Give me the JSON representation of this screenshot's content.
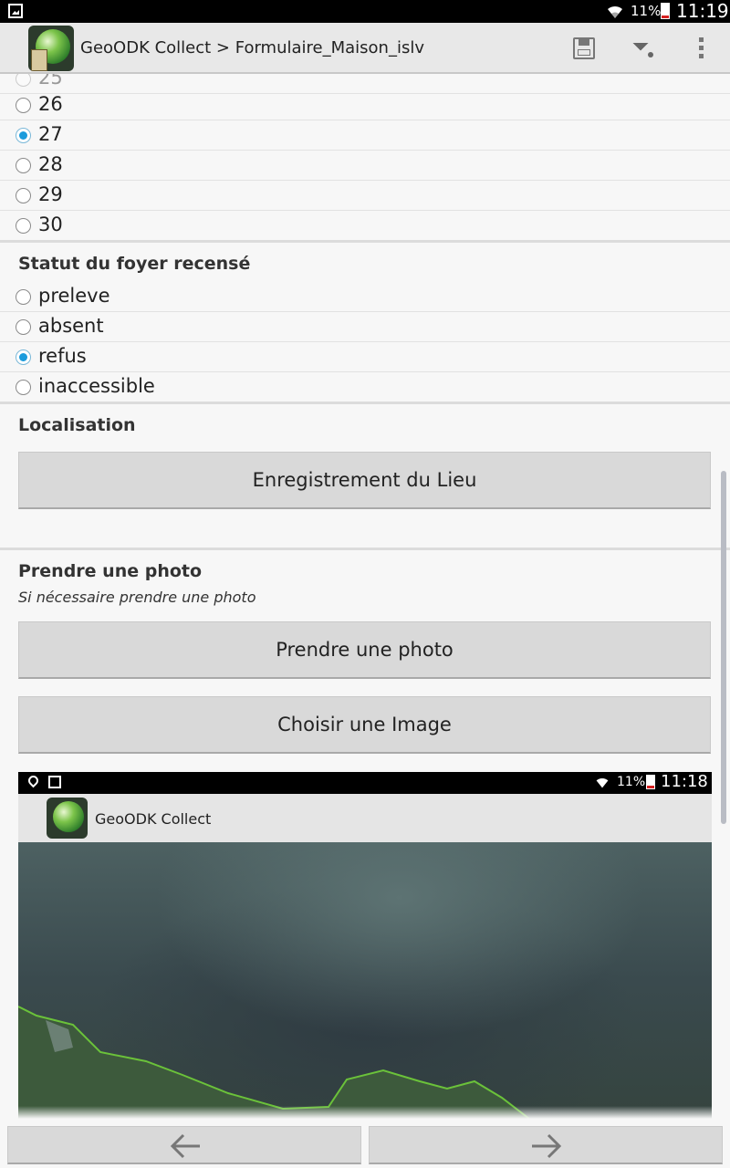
{
  "status_bar": {
    "battery": "11%",
    "time": "11:19"
  },
  "action_bar": {
    "title": "GeoODK Collect > Formulaire_Maison_islv"
  },
  "number_options": [
    {
      "label": "25",
      "selected": false,
      "partially_hidden": true
    },
    {
      "label": "26",
      "selected": false
    },
    {
      "label": "27",
      "selected": true
    },
    {
      "label": "28",
      "selected": false
    },
    {
      "label": "29",
      "selected": false
    },
    {
      "label": "30",
      "selected": false
    }
  ],
  "statut": {
    "label": "Statut du foyer recensé",
    "options": [
      {
        "label": "preleve",
        "selected": false
      },
      {
        "label": "absent",
        "selected": false
      },
      {
        "label": "refus",
        "selected": true
      },
      {
        "label": "inaccessible",
        "selected": false
      }
    ]
  },
  "localisation": {
    "label": "Localisation",
    "button": "Enregistrement du Lieu"
  },
  "photo": {
    "label": "Prendre une photo",
    "hint": "Si nécessaire prendre une photo",
    "take_button": "Prendre une photo",
    "choose_button": "Choisir une Image"
  },
  "photo_preview": {
    "battery": "11%",
    "time": "11:18",
    "app_title": "GeoODK Collect"
  },
  "colors": {
    "selected_radio": "#1a9bdc",
    "button_bg": "#d9d9d9",
    "status_bar": "#000000"
  }
}
